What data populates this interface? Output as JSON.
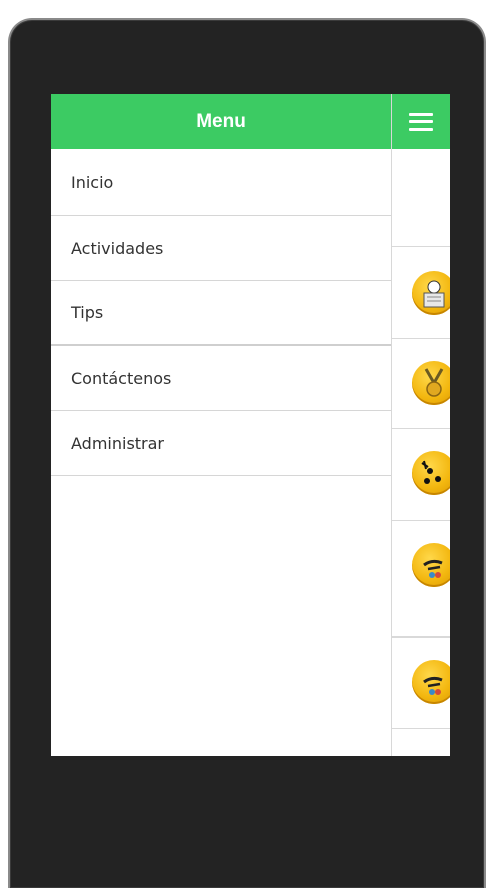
{
  "menu": {
    "title": "Menu",
    "items": [
      {
        "label": "Inicio"
      },
      {
        "label": "Actividades"
      },
      {
        "label": "Tips"
      },
      {
        "label": "Contáctenos"
      },
      {
        "label": "Administrar"
      }
    ]
  },
  "main": {
    "menu_button_icon": "hamburger-icon",
    "list_icons": [
      "newspaper-person-icon",
      "medal-icon",
      "cycling-race-icon",
      "runner-badge-icon",
      "runner-badge-icon"
    ]
  },
  "colors": {
    "header_green": "#3ccb63",
    "device_frame": "#232323",
    "icon_gold": "#f3b70f"
  }
}
